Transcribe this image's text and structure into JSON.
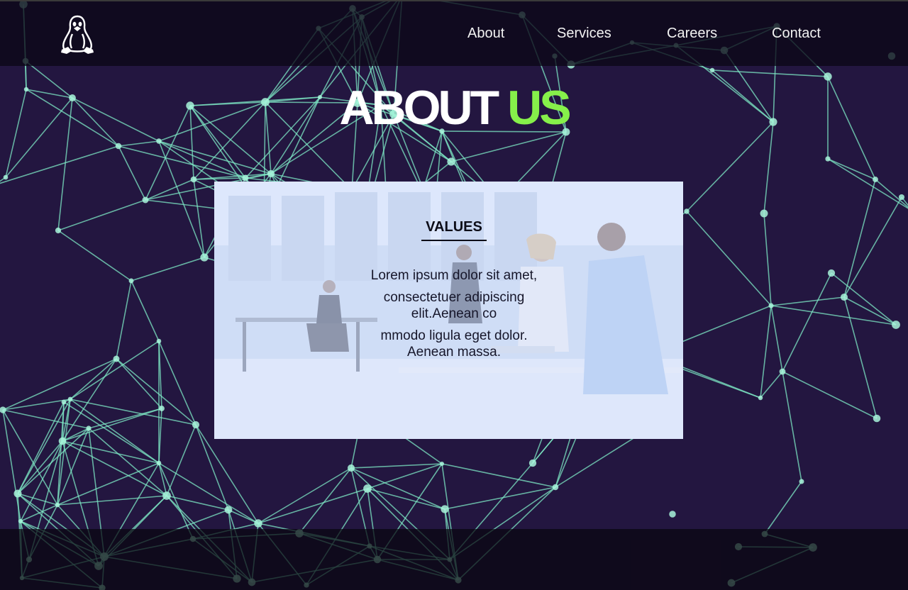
{
  "colors": {
    "background": "#231640",
    "network_line": "#7de8c4",
    "title_white": "#ffffff",
    "title_green": "#86f04a",
    "topbar": "#0c0816"
  },
  "header": {
    "logo_icon": "tux-penguin-icon",
    "nav": [
      {
        "label": "About"
      },
      {
        "label": "Services"
      },
      {
        "label": "Careers"
      },
      {
        "label": "Contact"
      }
    ]
  },
  "hero": {
    "title_part1": "ABOUT ",
    "title_part2": "US"
  },
  "values_card": {
    "heading": "VALUES",
    "paragraphs": [
      "Lorem ipsum dolor sit amet,",
      "consectetuer adipiscing elit.Aenean co",
      "mmodo ligula eget dolor. Aenean massa."
    ],
    "background_image": "office-meeting-photo"
  }
}
